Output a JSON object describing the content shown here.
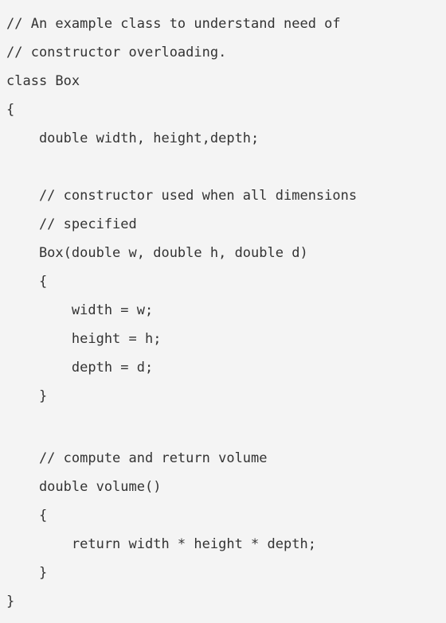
{
  "code": {
    "lines": [
      "// An example class to understand need of",
      "// constructor overloading.",
      "class Box",
      "{",
      "    double width, height,depth;",
      "",
      "    // constructor used when all dimensions",
      "    // specified",
      "    Box(double w, double h, double d)",
      "    {",
      "        width = w;",
      "        height = h;",
      "        depth = d;",
      "    }",
      "",
      "    // compute and return volume",
      "    double volume()",
      "    {",
      "        return width * height * depth;",
      "    }",
      "}"
    ]
  }
}
